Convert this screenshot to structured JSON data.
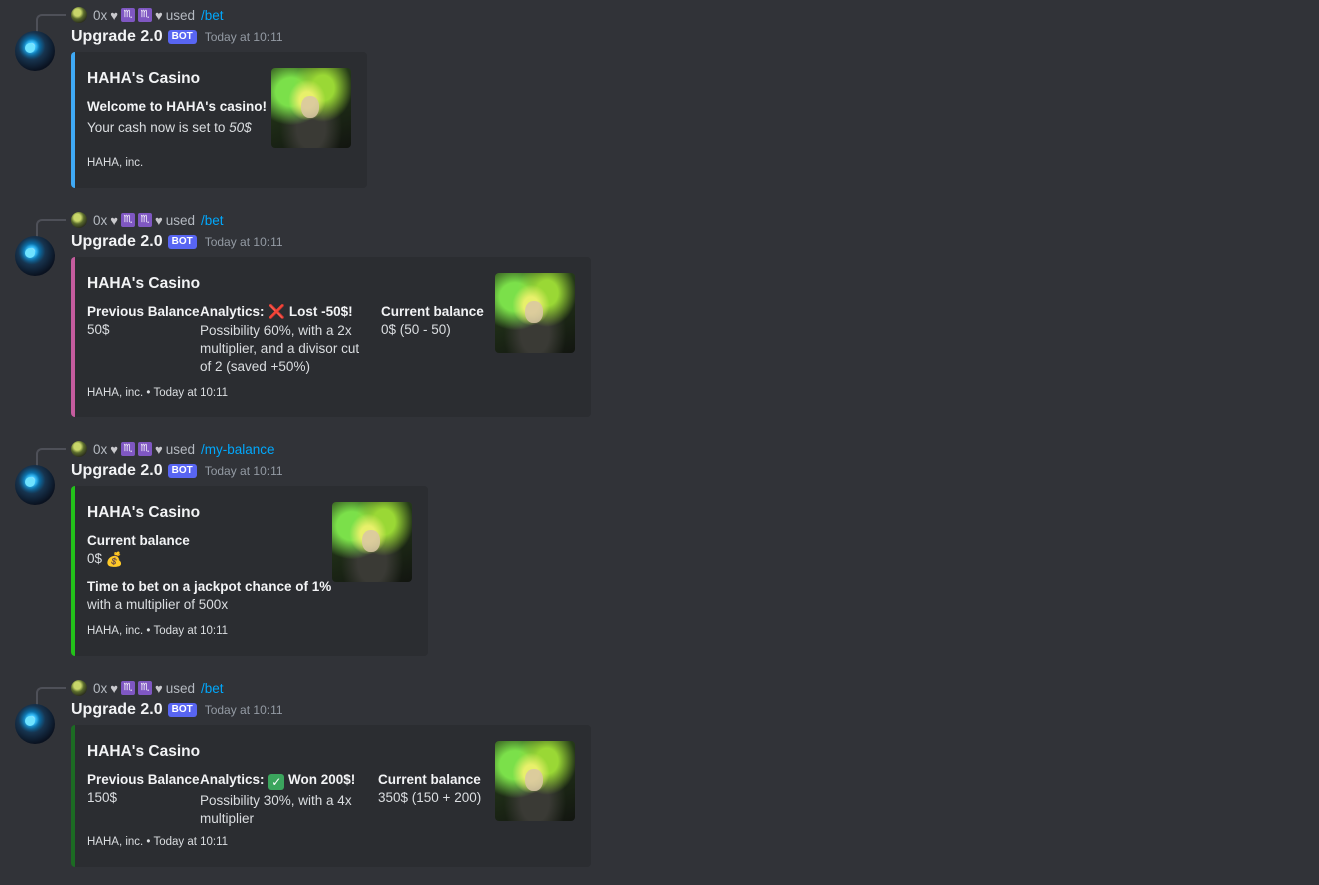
{
  "messages": [
    {
      "reply": {
        "user": "0x",
        "used": "used",
        "command": "/bet"
      },
      "author": "Upgrade 2.0",
      "bot_tag": "BOT",
      "time": "Today at 10:11",
      "embed": {
        "color": "#3fa9f5",
        "title": "HAHA's Casino",
        "description_bold": "Welcome to HAHA's casino!",
        "description_text": "Your cash now is set to ",
        "description_italic": "50$",
        "footer": "HAHA, inc."
      }
    },
    {
      "reply": {
        "user": "0x",
        "used": "used",
        "command": "/bet"
      },
      "author": "Upgrade 2.0",
      "bot_tag": "BOT",
      "time": "Today at 10:11",
      "embed": {
        "color": "#c55c9e",
        "title": "HAHA's Casino",
        "fields": [
          {
            "name": "Previous Balance",
            "value": "50$"
          },
          {
            "name_prefix": "Analytics: ",
            "name_icon": "❌",
            "name_suffix": " Lost -50$!",
            "value": "Possibility 60%, with a 2x multiplier, and a divisor cut of 2 (saved +50%)"
          },
          {
            "name": "Current balance",
            "value": "0$ (50 - 50)"
          }
        ],
        "footer": "HAHA, inc. • Today at 10:11"
      }
    },
    {
      "reply": {
        "user": "0x",
        "used": "used",
        "command": "/my-balance"
      },
      "author": "Upgrade 2.0",
      "bot_tag": "BOT",
      "time": "Today at 10:11",
      "embed": {
        "color": "#23c21a",
        "title": "HAHA's Casino",
        "fields": [
          {
            "name": "Current balance",
            "value": "0$",
            "icon": "💰"
          },
          {
            "name": "Time to bet on a jackpot chance of 1%",
            "value": "with a multiplier of 500x"
          }
        ],
        "footer": "HAHA, inc. • Today at 10:11"
      }
    },
    {
      "reply": {
        "user": "0x",
        "used": "used",
        "command": "/bet"
      },
      "author": "Upgrade 2.0",
      "bot_tag": "BOT",
      "time": "Today at 10:11",
      "embed": {
        "color": "#1c6b23",
        "title": "HAHA's Casino",
        "fields": [
          {
            "name": "Previous Balance",
            "value": "150$"
          },
          {
            "name_prefix": "Analytics: ",
            "name_icon": "✓",
            "name_suffix": " Won 200$!",
            "value": "Possibility 30%, with a 4x multiplier"
          },
          {
            "name": "Current balance",
            "value": "350$ (150 + 200)"
          }
        ],
        "footer": "HAHA, inc. • Today at 10:11"
      }
    }
  ],
  "icons": {
    "heart": "♥",
    "zodiac": "♏"
  }
}
